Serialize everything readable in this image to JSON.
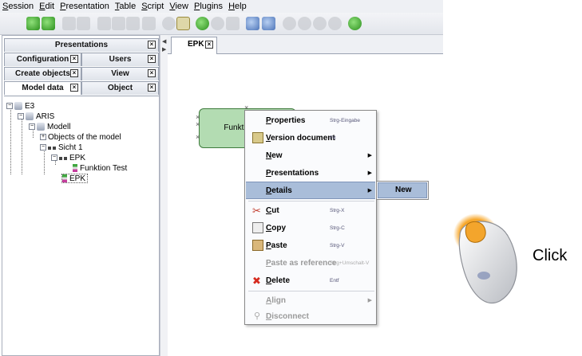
{
  "menubar": {
    "items": [
      "Session",
      "Edit",
      "Presentation",
      "Table",
      "Script",
      "View",
      "Plugins",
      "Help"
    ]
  },
  "left_panel": {
    "tabs_row1": [
      {
        "label": "Presentations"
      }
    ],
    "tabs_row2": [
      {
        "label": "Configuration"
      },
      {
        "label": "Users"
      }
    ],
    "tabs_row3": [
      {
        "label": "Create objects"
      },
      {
        "label": "View"
      }
    ],
    "tabs_row4": [
      {
        "label": "Model data"
      },
      {
        "label": "Object"
      }
    ],
    "close_glyph": "×"
  },
  "tree": {
    "nodes": [
      {
        "label": "E3"
      },
      {
        "label": "ARIS"
      },
      {
        "label": "Modell"
      },
      {
        "label": "Objects of the model"
      },
      {
        "label": "Sicht 1"
      },
      {
        "label": "EPK"
      },
      {
        "label": "Funktion Test"
      },
      {
        "label": "EPK"
      }
    ],
    "expanded_glyph": "−",
    "collapsed_glyph": "+"
  },
  "editor": {
    "tab_label": "EPK",
    "function_label": "Funktion Test"
  },
  "context_menu": {
    "items": [
      {
        "label": "Properties",
        "shortcut": "Strg-Eingabe"
      },
      {
        "label": "Version document",
        "shortcut": "F8"
      },
      {
        "label": "New",
        "arrow": "▶"
      },
      {
        "label": "Presentations",
        "arrow": "▶"
      },
      {
        "label": "Details",
        "arrow": "▶"
      },
      {
        "label": "Cut",
        "shortcut": "Strg-X"
      },
      {
        "label": "Copy",
        "shortcut": "Strg-C"
      },
      {
        "label": "Paste",
        "shortcut": "Strg-V"
      },
      {
        "label": "Paste as reference",
        "shortcut": "Strg+Umschalt-V"
      },
      {
        "label": "Delete",
        "shortcut": "Entf"
      },
      {
        "label": "Align",
        "arrow": "▶"
      },
      {
        "label": "Disconnect"
      }
    ]
  },
  "submenu": {
    "items": [
      {
        "label": "New"
      }
    ]
  },
  "overlay": {
    "click_label": "Click"
  },
  "colors": {
    "menu_highlight": "#a9bdd9",
    "function_fill": "#b3dcb2",
    "function_border": "#3e7b3c"
  }
}
